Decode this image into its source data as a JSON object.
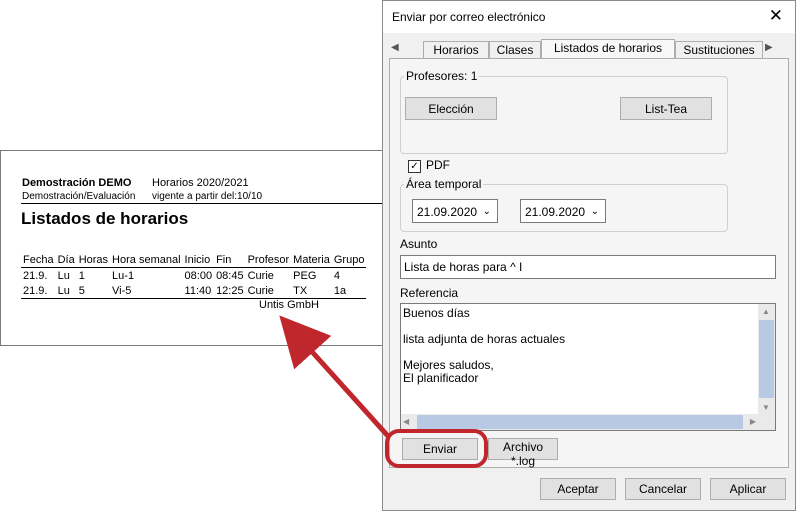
{
  "document": {
    "org": "Demostración  DEMO",
    "term": "Horarios 2020/2021",
    "subtitle": "Demostración/Evaluación",
    "valid_from": "vigente a partir del:10/10",
    "title": "Listados de horarios",
    "columns": [
      "Fecha",
      "Día",
      "Horas",
      "Hora semanal",
      "Inicio",
      "Fin",
      "Profesor",
      "Materia",
      "Grupo"
    ],
    "rows": [
      [
        "21.9.",
        "Lu",
        "1",
        "Lu-1",
        "08:00",
        "08:45",
        "Curie",
        "PEG",
        "4"
      ],
      [
        "21.9.",
        "Lu",
        "5",
        "Vi-5",
        "11:40",
        "12:25",
        "Curie",
        "TX",
        "1a"
      ]
    ],
    "footer": "Untis GmbH"
  },
  "dialog": {
    "title": "Enviar por correo electrónico",
    "tabs": [
      "Horarios",
      "Clases",
      "Listados de horarios",
      "Sustituciones"
    ],
    "active_tab": "Listados de horarios",
    "profesores_label": "Profesores: 1",
    "eleccion_btn": "Elección",
    "listtea_btn": "List-Tea",
    "pdf_label": "PDF",
    "pdf_checked": true,
    "area_temporal_label": "Área temporal",
    "date_from": "21.09.2020",
    "date_to": "21.09.2020",
    "asunto_label": "Asunto",
    "asunto_value": "Lista de horas para ^ I",
    "referencia_label": "Referencia",
    "referencia_lines": [
      "Buenos días",
      "",
      "lista adjunta de horas actuales",
      "",
      "Mejores saludos,",
      "El planificador"
    ],
    "enviar_btn": "Enviar",
    "archivo_log_btn": "Archivo *.log",
    "aceptar_btn": "Aceptar",
    "cancelar_btn": "Cancelar",
    "aplicar_btn": "Aplicar",
    "scroll_color": "#b8c9e3",
    "highlight_color": "#c0272d"
  }
}
